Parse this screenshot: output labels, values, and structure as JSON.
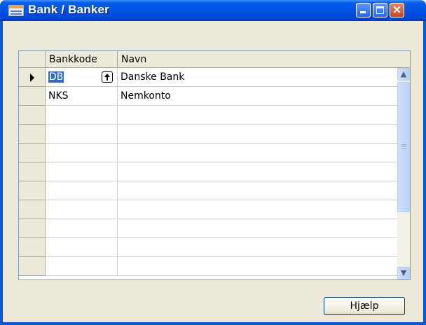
{
  "window": {
    "title": "Bank / Banker",
    "icons": {
      "app": "table-form-icon",
      "minimize": "minimize-icon",
      "maximize": "maximize-icon",
      "close": "close-icon"
    }
  },
  "table": {
    "columns": [
      "Bankkode",
      "Navn"
    ],
    "rows": [
      {
        "code": "DB",
        "name": "Danske Bank"
      },
      {
        "code": "NKS",
        "name": "Nemkonto"
      }
    ],
    "empty_row_count": 9,
    "lookup_icon": "lookup-arrow-icon",
    "current_row_indicator": "row-pointer-icon"
  },
  "scrollbar": {
    "up": "▲",
    "down": "▼"
  },
  "buttons": {
    "help": "Hjælp"
  },
  "colors": {
    "title_bar": "#0055e5",
    "selection": "#316ac5",
    "face": "#ece9d8"
  }
}
